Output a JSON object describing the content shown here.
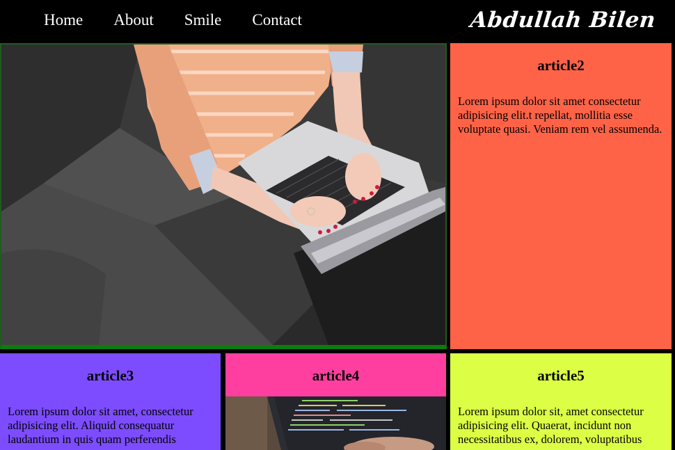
{
  "nav": {
    "items": [
      {
        "label": "Home"
      },
      {
        "label": "About"
      },
      {
        "label": "Smile"
      },
      {
        "label": "Contact"
      }
    ],
    "logo": "Abdullah Bilen"
  },
  "articles": {
    "article2": {
      "title": "article2",
      "text": "Lorem ipsum dolor sit amet consectetur adipisicing elit.t repellat, mollitia esse voluptate quasi. Veniam rem vel assumenda."
    },
    "article3": {
      "title": "article3",
      "text": "Lorem ipsum dolor sit amet, consectetur adipisicing elit. Aliquid consequatur laudantium in quis quam perferendis"
    },
    "article4": {
      "title": "article4"
    },
    "article5": {
      "title": "article5",
      "text": "Lorem ipsum dolor sit, amet consectetur adipisicing elit. Quaerat, incidunt non necessitatibus ex, dolorem, voluptatibus"
    }
  },
  "colors": {
    "article2": "#ff6347",
    "article3": "#7d4cff",
    "article4": "#ff3fa0",
    "article5": "#dcff45",
    "article1_border": "#0a7d0a"
  },
  "images": {
    "article1": "photo-person-typing-on-laptop-on-gray-sofa",
    "article4": "photo-laptop-screen-with-code"
  }
}
